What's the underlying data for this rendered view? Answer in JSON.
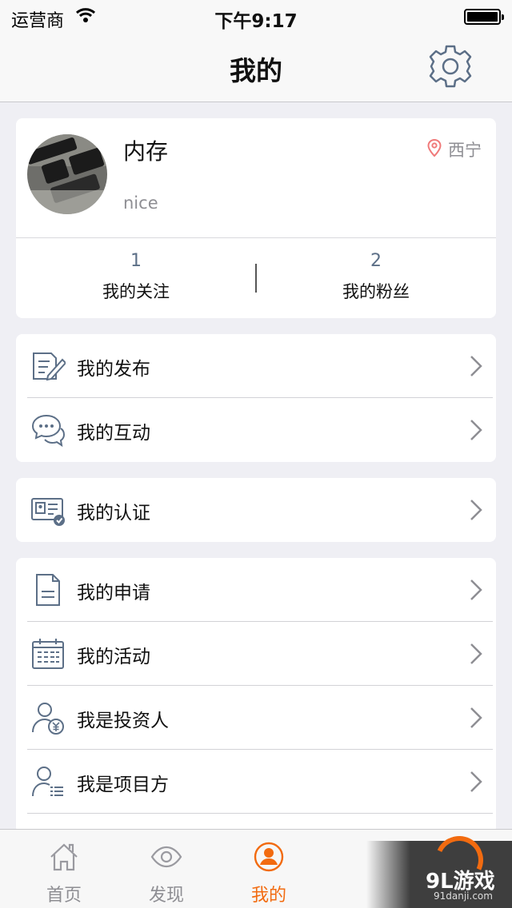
{
  "status_bar": {
    "carrier": "运营商",
    "time": "下午9:17"
  },
  "nav": {
    "title": "我的"
  },
  "profile": {
    "name": "内存",
    "bio": "nice",
    "location": "西宁",
    "following": {
      "count": "1",
      "label": "我的关注"
    },
    "followers": {
      "count": "2",
      "label": "我的粉丝"
    }
  },
  "menu": {
    "group1": [
      {
        "label": "我的发布",
        "icon": "edit-document-icon"
      },
      {
        "label": "我的互动",
        "icon": "chat-bubbles-icon"
      }
    ],
    "group2": [
      {
        "label": "我的认证",
        "icon": "id-card-verified-icon"
      }
    ],
    "group3": [
      {
        "label": "我的申请",
        "icon": "document-icon"
      },
      {
        "label": "我的活动",
        "icon": "calendar-icon"
      },
      {
        "label": "我是投资人",
        "icon": "investor-icon"
      },
      {
        "label": "我是项目方",
        "icon": "project-owner-icon"
      }
    ]
  },
  "tabs": [
    {
      "label": "首页",
      "icon": "home-icon",
      "active": false
    },
    {
      "label": "发现",
      "icon": "eye-icon",
      "active": false
    },
    {
      "label": "我的",
      "icon": "user-circle-icon",
      "active": true
    }
  ],
  "watermark": {
    "text": "9L游戏",
    "sub": "91danji.com"
  },
  "colors": {
    "accent": "#f26b10",
    "icon": "#5c6f87",
    "background": "#efeff4"
  }
}
